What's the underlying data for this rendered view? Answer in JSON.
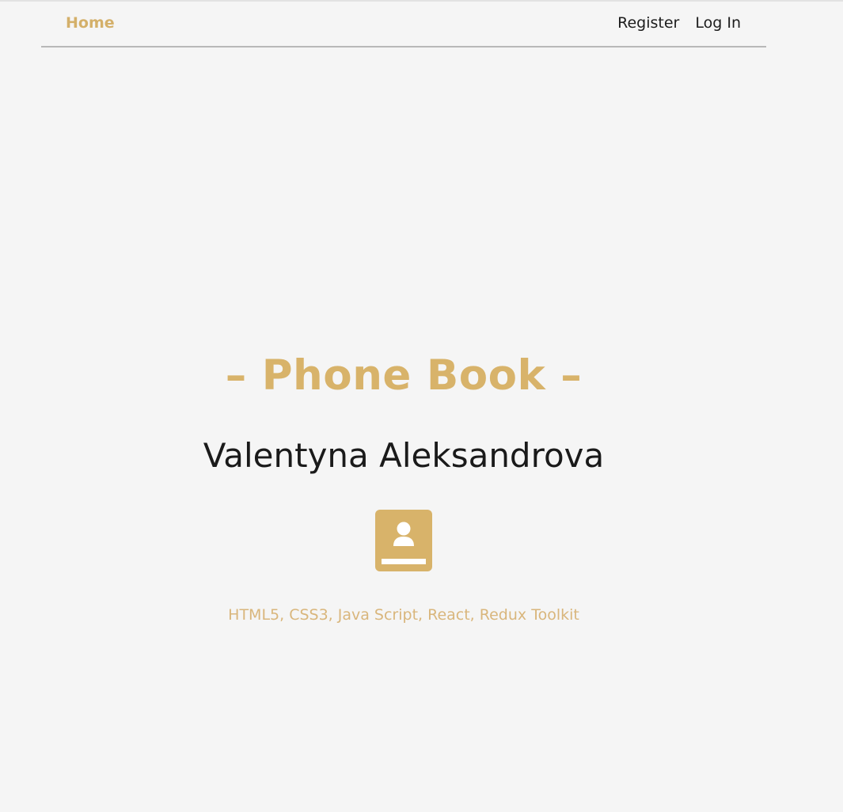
{
  "nav": {
    "home_label": "Home",
    "register_label": "Register",
    "login_label": "Log In"
  },
  "hero": {
    "title": "– Phone Book –",
    "author": "Valentyna Aleksandrova",
    "icon": "contact-book-icon",
    "tech_stack": "HTML5, CSS3, Java Script, React, Redux Toolkit"
  },
  "colors": {
    "accent": "#d8b36a",
    "text": "#1a1a1a",
    "background": "#f5f5f5"
  }
}
